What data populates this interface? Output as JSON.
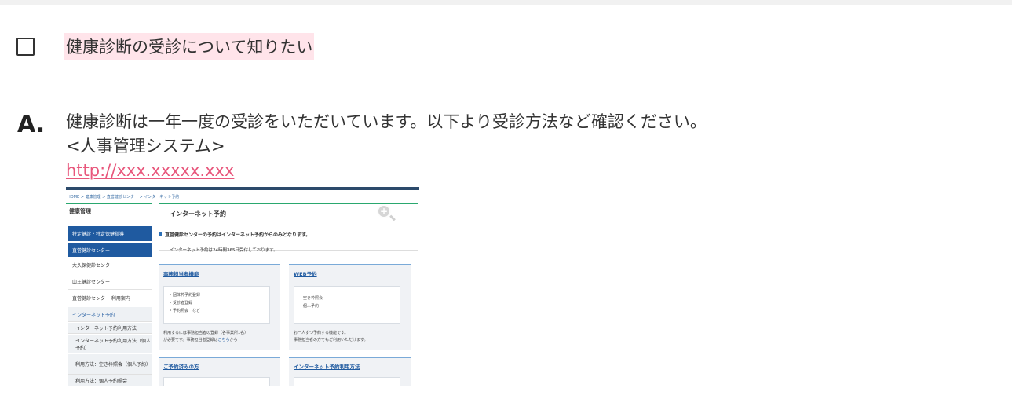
{
  "question": {
    "text": "健康診断の受診について知りたい"
  },
  "answer": {
    "label": "A.",
    "line1": "健康診断は一年一度の受診をいただいています。以下より受診方法など確認ください。",
    "line2": "<人事管理システム>",
    "link": "http://xxx.xxxxx.xxx"
  },
  "screenshot": {
    "breadcrumb": "HOME > 健康管理 > 直営健診センター > インターネット予約",
    "sidebar": {
      "heading": "健康管理",
      "items": [
        "特定健診・特定保健指導",
        "直営健診センター",
        "大久保健診センター",
        "山王健診センター",
        "直営健診センター 利用案内",
        "インターネット予約",
        "インターネット予約利用方法",
        "インターネット予約利用方法（個人予約）",
        "利用方法：空き枠照会（個人予約）",
        "利用方法：個人予約照会"
      ]
    },
    "main": {
      "title": "インターネット予約",
      "notice": "直営健診センターの予約はインターネット予約からのみとなります。",
      "subtext": "インターネット予約は24時間365日受付しております。",
      "cards": [
        {
          "title": "事務担当者機能",
          "items": [
            "・団体枠予約登録",
            "・受診者登録",
            "・予約照会　など"
          ],
          "note1": "利用するには事務担当者の登録（各事業所1名）",
          "note2a": "が必要です。事務担当者登録は",
          "note2link": "こちら",
          "note2b": "から"
        },
        {
          "title": "WEB予約",
          "items": [
            "・空き枠照会",
            "・個人予約"
          ],
          "note1": "お一人ずつ予約する機能です。",
          "note2a": "事務担当者の方でもご利用いただけます。"
        },
        {
          "title": "ご予約済みの方"
        },
        {
          "title": "インターネット予約利用方法"
        }
      ]
    },
    "zoom_icon": "zoom-in-icon"
  }
}
